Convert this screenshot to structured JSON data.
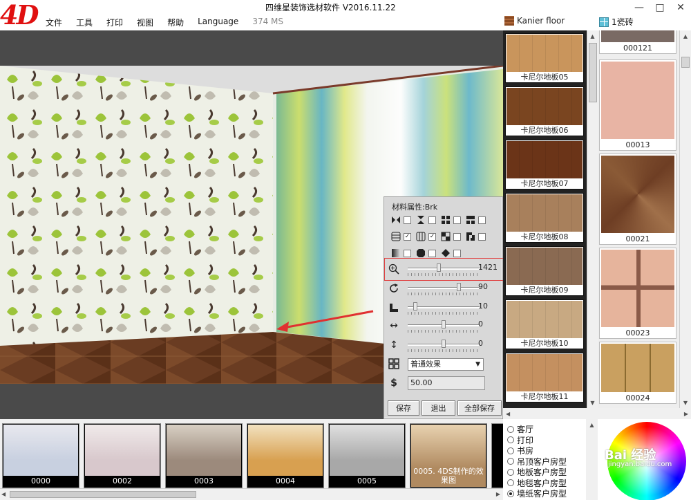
{
  "app": {
    "logo": "4D",
    "title": "四维星装饰选材软件  V2016.11.22",
    "window_controls": [
      "—",
      "□",
      "✕"
    ]
  },
  "menu": {
    "items": [
      "文件",
      "工具",
      "打印",
      "视图",
      "帮助",
      "Language"
    ],
    "latency": "374 MS"
  },
  "material_headers": {
    "floor": "Kanier floor",
    "tile": "1瓷砖"
  },
  "material_panel": {
    "title": "材料属性:Brk",
    "row1_checks": [
      false,
      false,
      false,
      false
    ],
    "row2_checks": [
      true,
      true,
      false,
      false
    ],
    "row3_checks": [
      false,
      false,
      false
    ],
    "sliders": [
      {
        "name": "zoom",
        "icon": "zoom-icon",
        "value": "1421",
        "position": 0.43
      },
      {
        "name": "rotate",
        "icon": "rotate-icon",
        "value": "90",
        "position": 0.72
      },
      {
        "name": "height",
        "icon": "height-icon",
        "value": "10",
        "position": 0.08
      },
      {
        "name": "offset-x",
        "icon": "horizontal-arrow-icon",
        "value": "0",
        "position": 0.5
      },
      {
        "name": "offset-y",
        "icon": "vertical-arrow-icon",
        "value": "0",
        "position": 0.5
      }
    ],
    "effect": "普通效果",
    "price": "50.00",
    "buttons": {
      "save": "保存",
      "exit": "退出",
      "save_all": "全部保存"
    }
  },
  "floor_tiles": [
    {
      "label": "卡尼尔地板05",
      "color": "#c9955c"
    },
    {
      "label": "卡尼尔地板06",
      "color": "#7a4520"
    },
    {
      "label": "卡尼尔地板07",
      "color": "#6b3418"
    },
    {
      "label": "卡尼尔地板08",
      "color": "#a8805c"
    },
    {
      "label": "卡尼尔地板09",
      "color": "#8a6a52"
    },
    {
      "label": "卡尼尔地板10",
      "color": "#c8a982"
    },
    {
      "label": "卡尼尔地板11",
      "color": "#c49060"
    }
  ],
  "ceramic_tiles": [
    {
      "label": "000121",
      "color": "#7a6a64"
    },
    {
      "label": "00013",
      "color": "#e8b4a4"
    },
    {
      "label": "00021",
      "color": "#6e3e24"
    },
    {
      "label": "00023",
      "color": "#e6b49c"
    },
    {
      "label": "00024",
      "color": "#c9a060"
    }
  ],
  "scenes": [
    {
      "label": "0000",
      "colors": [
        "#c8d0e0",
        "#e8e8ee"
      ]
    },
    {
      "label": "0002",
      "colors": [
        "#d8c8cc",
        "#f0eaea"
      ]
    },
    {
      "label": "0003",
      "colors": [
        "#9c8a7c",
        "#d8d0c4"
      ]
    },
    {
      "label": "0004",
      "colors": [
        "#d8a050",
        "#f2e2c0"
      ]
    },
    {
      "label": "0005",
      "colors": [
        "#a8a8a8",
        "#e0e0e0"
      ]
    },
    {
      "label": "0005. 4DS制作的效果图",
      "colors": [
        "#b08a60",
        "#e8d2b0"
      ]
    }
  ],
  "rooms": [
    {
      "label": "客厅",
      "selected": false
    },
    {
      "label": "打印",
      "selected": false
    },
    {
      "label": "书房",
      "selected": false
    },
    {
      "label": "吊顶客户房型",
      "selected": false
    },
    {
      "label": "地板客户房型",
      "selected": false
    },
    {
      "label": "地毯客户房型",
      "selected": false
    },
    {
      "label": "墙纸客户房型",
      "selected": true
    }
  ],
  "watermark": {
    "main": "Bai 经验",
    "sub": "jingyan.baidu.com"
  }
}
